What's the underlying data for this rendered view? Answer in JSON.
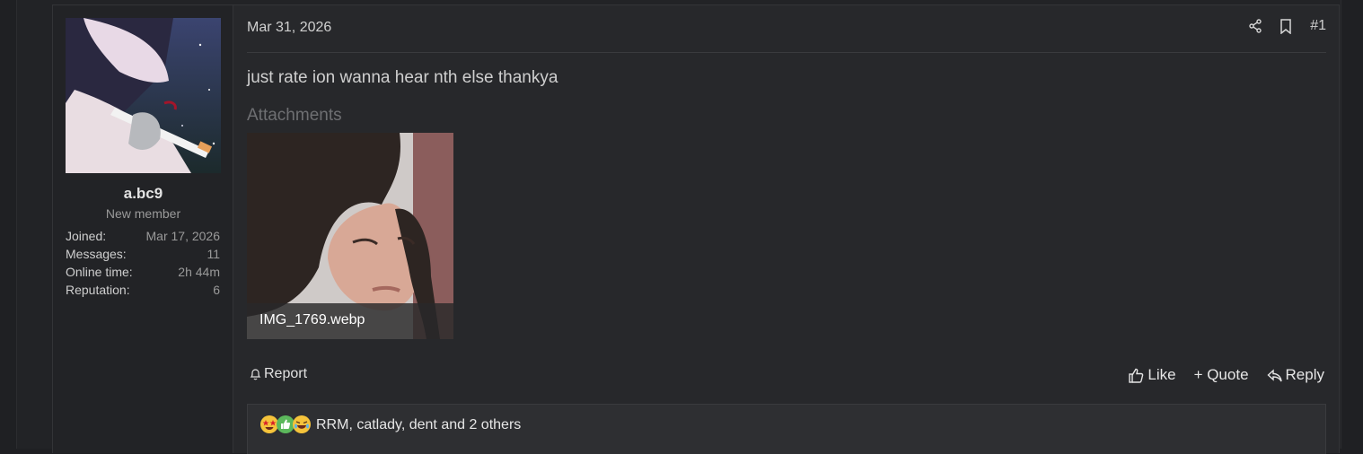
{
  "user": {
    "username": "a.bc9",
    "title": "New member",
    "stats": [
      {
        "label": "Joined:",
        "value": "Mar 17, 2026"
      },
      {
        "label": "Messages:",
        "value": "11"
      },
      {
        "label": "Online time:",
        "value": "2h 44m"
      },
      {
        "label": "Reputation:",
        "value": "6"
      }
    ]
  },
  "post": {
    "date": "Mar 31, 2026",
    "number": "#1",
    "body": "just rate ion wanna hear nth else thankya",
    "attachments_title": "Attachments",
    "attachment_filename": "IMG_1769.webp"
  },
  "actions": {
    "report": "Report",
    "like": "Like",
    "quote": "+ Quote",
    "reply": "Reply"
  },
  "reactions": {
    "icons": [
      "star-struck-emoji",
      "thumbs-up-emoji",
      "laughing-emoji"
    ],
    "text": "RRM, catlady, dent and 2 others"
  },
  "colors": {
    "page_bg": "#1f2023",
    "message_bg": "#27282b",
    "user_cell_bg": "#222326",
    "muted_text": "#9a9a9a",
    "like_green": "#5cb85c",
    "emoji_yellow": "#f5c33b"
  }
}
